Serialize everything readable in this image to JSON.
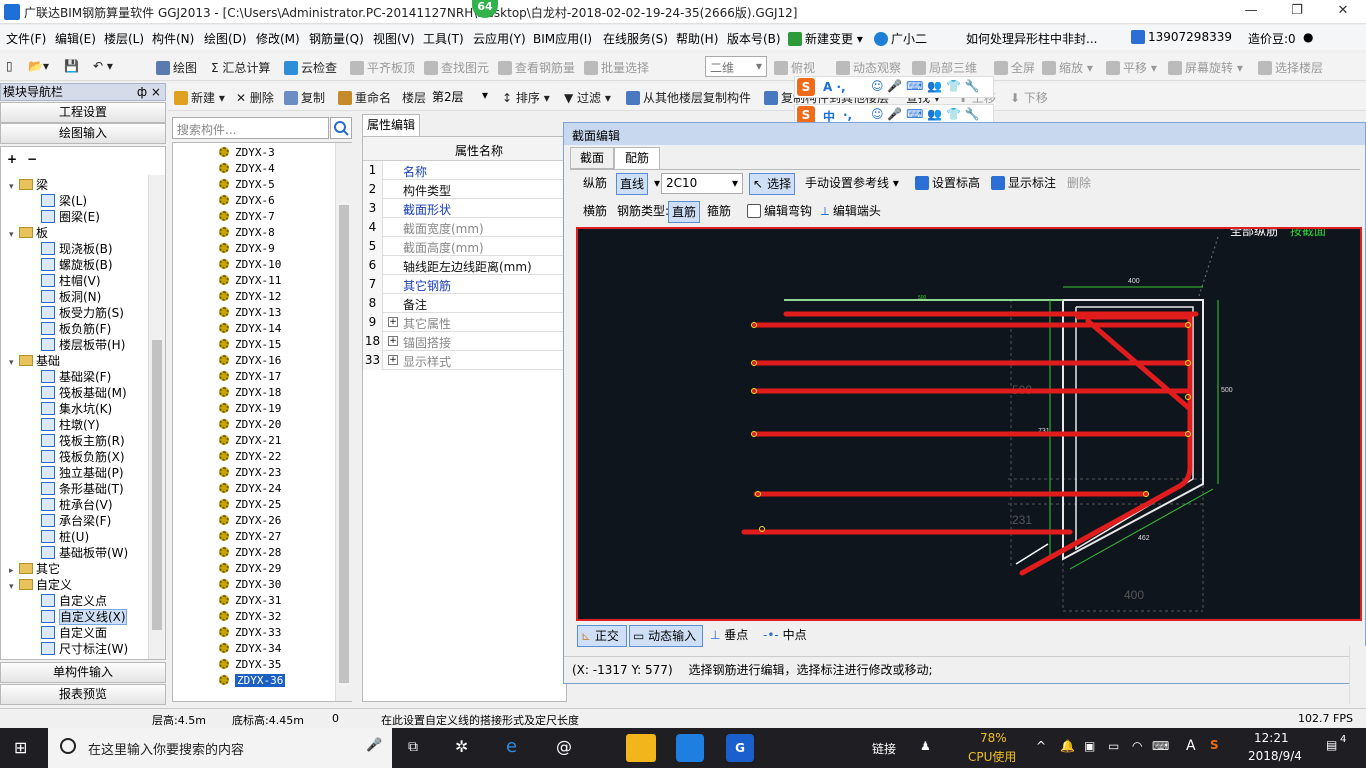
{
  "window": {
    "title": "广联达BIM钢筋算量软件 GGJ2013 - [C:\\Users\\Administrator.PC-20141127NRH\\Desktop\\白龙村-2018-02-02-19-24-35(2666版).GGJ12]",
    "badge": "64"
  },
  "menu": [
    "文件(F)",
    "编辑(E)",
    "楼层(L)",
    "构件(N)",
    "绘图(D)",
    "修改(M)",
    "钢筋量(Q)",
    "视图(V)",
    "工具(T)",
    "云应用(Y)",
    "BIM应用(I)",
    "在线服务(S)",
    "帮助(H)",
    "版本号(B)"
  ],
  "menu_right": {
    "new_change": "新建变更",
    "assistant": "广小二",
    "question": "如何处理异形柱中非封...",
    "phone": "13907298339",
    "beans": "造价豆:0"
  },
  "toolbar1": {
    "draw": "绘图",
    "sum": "汇总计算",
    "cloud_check": "云检查",
    "flush_slab": "平齐板顶",
    "find_elem": "查找图元",
    "view_rebar": "查看钢筋量",
    "batch_select": "批量选择",
    "view_mode": "二维",
    "top_view": "俯视",
    "dynamic": "动态观察",
    "local3d": "局部三维",
    "fullscreen": "全屏",
    "zoom": "缩放",
    "pan": "平移",
    "rotate": "屏幕旋转",
    "select_floor": "选择楼层"
  },
  "toolbar2": {
    "new": "新建",
    "delete": "删除",
    "copy": "复制",
    "rename": "重命名",
    "floor_label": "楼层",
    "floor": "第2层",
    "sort": "排序",
    "filter": "过滤",
    "copy_from": "从其他楼层复制构件",
    "copy_to": "复制构件到其他楼层",
    "find": "查找",
    "up": "上移",
    "down": "下移"
  },
  "nav": {
    "header": "模块导航栏",
    "pin": "ф ×",
    "top_buttons": [
      "工程设置",
      "绘图输入"
    ],
    "tree": [
      {
        "label": "梁",
        "level": 0,
        "type": "folder"
      },
      {
        "label": "梁(L)",
        "level": 1,
        "type": "leaf"
      },
      {
        "label": "圈梁(E)",
        "level": 1,
        "type": "leaf"
      },
      {
        "label": "板",
        "level": 0,
        "type": "folder"
      },
      {
        "label": "现浇板(B)",
        "level": 1,
        "type": "leaf"
      },
      {
        "label": "螺旋板(B)",
        "level": 1,
        "type": "leaf"
      },
      {
        "label": "柱帽(V)",
        "level": 1,
        "type": "leaf"
      },
      {
        "label": "板洞(N)",
        "level": 1,
        "type": "leaf"
      },
      {
        "label": "板受力筋(S)",
        "level": 1,
        "type": "leaf"
      },
      {
        "label": "板负筋(F)",
        "level": 1,
        "type": "leaf"
      },
      {
        "label": "楼层板带(H)",
        "level": 1,
        "type": "leaf"
      },
      {
        "label": "基础",
        "level": 0,
        "type": "folder"
      },
      {
        "label": "基础梁(F)",
        "level": 1,
        "type": "leaf"
      },
      {
        "label": "筏板基础(M)",
        "level": 1,
        "type": "leaf"
      },
      {
        "label": "集水坑(K)",
        "level": 1,
        "type": "leaf"
      },
      {
        "label": "柱墩(Y)",
        "level": 1,
        "type": "leaf"
      },
      {
        "label": "筏板主筋(R)",
        "level": 1,
        "type": "leaf"
      },
      {
        "label": "筏板负筋(X)",
        "level": 1,
        "type": "leaf"
      },
      {
        "label": "独立基础(P)",
        "level": 1,
        "type": "leaf"
      },
      {
        "label": "条形基础(T)",
        "level": 1,
        "type": "leaf"
      },
      {
        "label": "桩承台(V)",
        "level": 1,
        "type": "leaf"
      },
      {
        "label": "承台梁(F)",
        "level": 1,
        "type": "leaf"
      },
      {
        "label": "桩(U)",
        "level": 1,
        "type": "leaf"
      },
      {
        "label": "基础板带(W)",
        "level": 1,
        "type": "leaf"
      },
      {
        "label": "其它",
        "level": 0,
        "type": "folder-collapsed"
      },
      {
        "label": "自定义",
        "level": 0,
        "type": "folder"
      },
      {
        "label": "自定义点",
        "level": 1,
        "type": "leaf"
      },
      {
        "label": "自定义线(X)",
        "level": 1,
        "type": "leaf",
        "selected": true
      },
      {
        "label": "自定义面",
        "level": 1,
        "type": "leaf"
      },
      {
        "label": "尺寸标注(W)",
        "level": 1,
        "type": "leaf"
      }
    ],
    "bottom_buttons": [
      "单构件输入",
      "报表预览"
    ]
  },
  "components": {
    "search_placeholder": "搜索构件...",
    "items": [
      "ZDYX-3",
      "ZDYX-4",
      "ZDYX-5",
      "ZDYX-6",
      "ZDYX-7",
      "ZDYX-8",
      "ZDYX-9",
      "ZDYX-10",
      "ZDYX-11",
      "ZDYX-12",
      "ZDYX-13",
      "ZDYX-14",
      "ZDYX-15",
      "ZDYX-16",
      "ZDYX-17",
      "ZDYX-18",
      "ZDYX-19",
      "ZDYX-20",
      "ZDYX-21",
      "ZDYX-22",
      "ZDYX-23",
      "ZDYX-24",
      "ZDYX-25",
      "ZDYX-26",
      "ZDYX-27",
      "ZDYX-28",
      "ZDYX-29",
      "ZDYX-30",
      "ZDYX-31",
      "ZDYX-32",
      "ZDYX-33",
      "ZDYX-34",
      "ZDYX-35",
      "ZDYX-36"
    ],
    "selected": "ZDYX-36"
  },
  "properties": {
    "tab": "属性编辑",
    "header": "属性名称",
    "rows": [
      {
        "num": "1",
        "name": "名称",
        "style": "blue"
      },
      {
        "num": "2",
        "name": "构件类型",
        "style": "normal"
      },
      {
        "num": "3",
        "name": "截面形状",
        "style": "blue"
      },
      {
        "num": "4",
        "name": "截面宽度(mm)",
        "style": "gray"
      },
      {
        "num": "5",
        "name": "截面高度(mm)",
        "style": "gray"
      },
      {
        "num": "6",
        "name": "轴线距左边线距离(mm)",
        "style": "normal"
      },
      {
        "num": "7",
        "name": "其它钢筋",
        "style": "blue"
      },
      {
        "num": "8",
        "name": "备注",
        "style": "normal"
      },
      {
        "num": "9",
        "name": "其它属性",
        "style": "gray",
        "expandable": true
      },
      {
        "num": "18",
        "name": "锚固搭接",
        "style": "gray",
        "expandable": true
      },
      {
        "num": "33",
        "name": "显示样式",
        "style": "gray",
        "expandable": true
      }
    ]
  },
  "section_editor": {
    "title": "截面编辑",
    "tabs": [
      "截面",
      "配筋"
    ],
    "active_tab": "配筋",
    "row1": {
      "longitudinal": "纵筋",
      "line": "直线",
      "spec": "2C10",
      "select": "选择",
      "manual_ref": "手动设置参考线",
      "set_elev": "设置标高",
      "show_dim": "显示标注",
      "delete": "删除"
    },
    "row2": {
      "transverse": "横筋",
      "type_label": "钢筋类型:",
      "straight": "直筋",
      "stirrup": "箍筋",
      "edit_hook": "编辑弯钩",
      "edit_end": "编辑端头"
    },
    "canvas_text": {
      "corner_note": "全部纵筋",
      "corner_note_green": "按截面",
      "dim_top": "400",
      "dim_top_small": "500",
      "dim_right": "500",
      "dim_left_faded": "500",
      "dim_731": "731",
      "dim_231": "231",
      "dim_462": "462",
      "dim_bottom": "400"
    },
    "bottom_tools": {
      "ortho": "正交",
      "dyn_input": "动态输入",
      "perp": "垂点",
      "mid": "中点"
    },
    "status": {
      "coords": "(X: -1317 Y: 577)",
      "hint": "选择钢筋进行编辑，选择标注进行修改或移动;"
    }
  },
  "app_status": {
    "floor_height": "层高:4.5m",
    "bottom_elev": "底标高:4.45m",
    "zero": "0",
    "hint": "在此设置自定义线的搭接形式及定尺长度",
    "fps": "102.7 FPS"
  },
  "taskbar": {
    "search_placeholder": "在这里输入你要搜索的内容",
    "link": "链接",
    "cpu_pct": "78%",
    "cpu_label": "CPU使用",
    "ime": "A",
    "time": "12:21",
    "date": "2018/9/4",
    "notif": "4"
  },
  "ime_bar": {
    "mode": "中"
  }
}
